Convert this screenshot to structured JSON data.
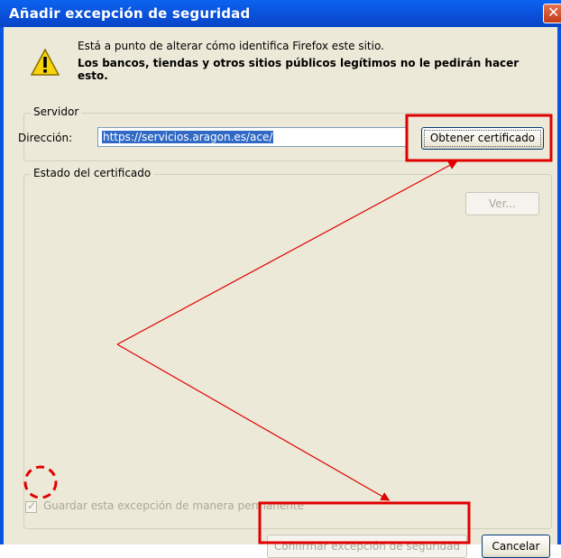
{
  "window": {
    "title": "Añadir excepción de seguridad",
    "close_glyph": "✕"
  },
  "warning": {
    "icon": "warning-triangle-icon",
    "line1": "Está a punto de alterar cómo identifica Firefox este sitio.",
    "line2": "Los bancos, tiendas y otros sitios públicos legítimos no le pedirán hacer esto."
  },
  "server": {
    "group_label": "Servidor",
    "address_label": "Dirección:",
    "address_value": "https://servicios.aragon.es/ace/",
    "get_certificate_button": "Obtener certificado"
  },
  "certificate": {
    "group_label": "Estado del certificado",
    "view_button": "Ver...",
    "permanent_checkbox_label": "Guardar esta excepción de manera permanente",
    "permanent_checked": true
  },
  "footer": {
    "confirm_button": "Confirmar excepción de seguridad",
    "cancel_button": "Cancelar"
  },
  "annotations": {
    "color": "#e00000",
    "arrow_color": "#e00000"
  }
}
